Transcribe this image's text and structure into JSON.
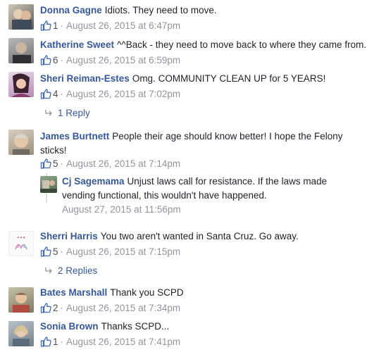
{
  "comments": [
    {
      "author": "Donna Gagne",
      "text": "Idiots. They need to move.",
      "likes": "1",
      "time": "August 26, 2015 at 6:47pm"
    },
    {
      "author": "Katherine Sweet",
      "text": "^^Back - they need to move back to where they came from.",
      "likes": "6",
      "time": "August 26, 2015 at 6:59pm"
    },
    {
      "author": "Sheri Reiman-Estes",
      "text": "Omg. COMMUNITY CLEAN UP for 5 YEARS!",
      "likes": "4",
      "time": "August 26, 2015 at 7:02pm",
      "replies_label": "1 Reply"
    },
    {
      "author": "James Burtnett",
      "text": "People their age should know better! I hope the Felony sticks!",
      "likes": "5",
      "time": "August 26, 2015 at 7:14pm"
    },
    {
      "author": "Cj Sagemama",
      "text": "Unjust laws call for resistance. If the laws made vending functional, this wouldn't have happened.",
      "time": "August 27, 2015 at 11:56pm"
    },
    {
      "author": "Sherri Harris",
      "text": "You two aren't wanted in Santa Cruz. Go away.",
      "likes": "5",
      "time": "August 26, 2015 at 7:15pm",
      "replies_label": "2 Replies"
    },
    {
      "author": "Bates Marshall",
      "text": "Thank you SCPD",
      "likes": "2",
      "time": "August 26, 2015 at 7:34pm"
    },
    {
      "author": "Sonia Brown",
      "text": "Thanks SCPD...",
      "likes": "1",
      "time": "August 26, 2015 at 7:41pm"
    }
  ],
  "separator": "·",
  "colors": {
    "link": "#365899",
    "meta": "#90949c",
    "like": "#4267b2"
  },
  "icons": {
    "like": "thumbs-up-icon",
    "reply_arrow": "reply-arrow-icon"
  }
}
